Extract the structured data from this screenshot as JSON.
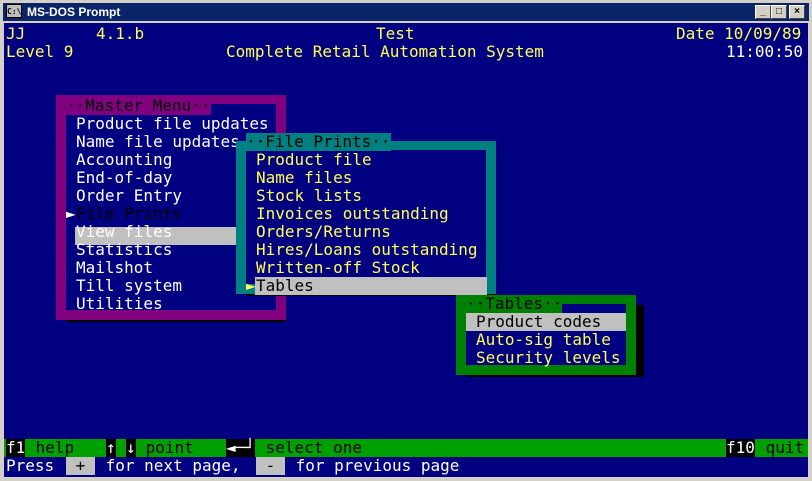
{
  "window": {
    "title": "MS-DOS Prompt",
    "icon_text": "C:\\",
    "min_glyph": "_",
    "max_glyph": "□",
    "close_glyph": "×"
  },
  "header": {
    "user": "JJ",
    "version": "4.1.b",
    "mode": "Test",
    "date": "Date 10/09/89",
    "level": "Level 9",
    "system_name": "Complete Retail Automation System",
    "time": "11:00:50"
  },
  "master_menu": {
    "title": "··Master Menu··",
    "items": [
      "Product file updates",
      "Name file updates",
      "Accounting",
      "End-of-day",
      "Order Entry",
      "File Prints",
      "View files",
      "Statistics",
      "Mailshot",
      "Till system",
      "Utilities"
    ],
    "selected_marker": "►",
    "selected_item": "File Prints"
  },
  "file_prints_menu": {
    "title": "··File Prints··",
    "items": [
      "Product file",
      "Name files",
      "Stock lists",
      "Invoices outstanding",
      "Orders/Returns",
      "Hires/Loans outstanding",
      "Written-off Stock",
      "Tables"
    ],
    "selected_marker": "►",
    "selected_item": "Tables"
  },
  "tables_menu": {
    "title": "··Tables··",
    "items": [
      "Product codes",
      "Auto-sig table",
      "Security levels"
    ],
    "selected_item": "Product codes"
  },
  "status_bar": {
    "f1_key": "f1",
    "f1_label": " help",
    "up_key": "↑",
    "down_key": "↓",
    "point_label": " point",
    "enter_key": "◄─┘",
    "select_label": " select one",
    "f10_key": "f10",
    "f10_label": " quit"
  },
  "page_bar": {
    "press": "Press",
    "plus_key": " + ",
    "next_text": " for next page,",
    "minus_key": " - ",
    "prev_text": " for previous page"
  },
  "colors": {
    "screen_bg": "#000080",
    "master_border": "#800080",
    "file_prints_border": "#008080",
    "tables_border": "#008000",
    "status_bg": "#00a000",
    "text_yellow": "#ffff55",
    "highlight": "#c0c0c0"
  }
}
